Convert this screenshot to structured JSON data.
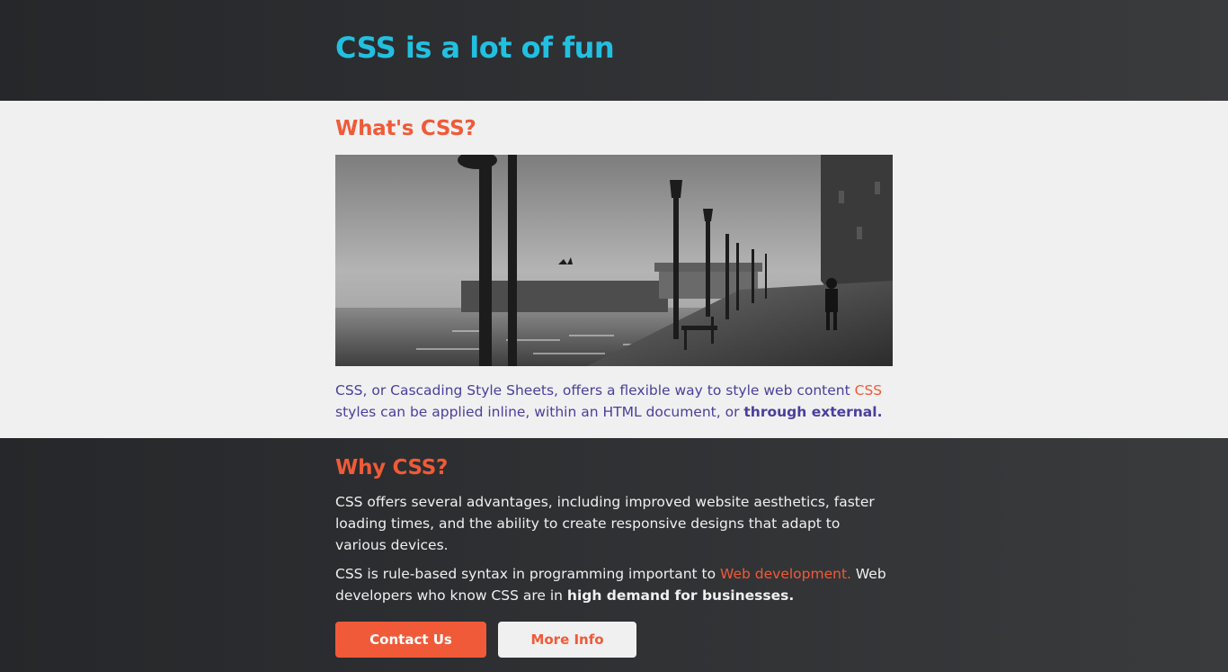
{
  "header": {
    "title": "CSS is a lot of fun"
  },
  "whats_css": {
    "heading": "What's CSS?",
    "paragraph_start": "CSS, or Cascading Style Sheets, offers a flexible way to style web content ",
    "paragraph_accent": "CSS",
    "paragraph_middle": " styles can be applied inline, within an HTML document, or ",
    "paragraph_bold": "through external."
  },
  "why_css": {
    "heading": "Why CSS?",
    "paragraph1": "CSS offers several advantages, including improved website aesthetics, faster loading times, and the ability to create responsive designs that adapt to various devices.",
    "paragraph2_start": "CSS is rule-based syntax in programming important to ",
    "paragraph2_accent": "Web development.",
    "paragraph2_middle": " Web developers who know CSS are in ",
    "paragraph2_bold": "high demand for businesses.",
    "contact_button": "Contact Us",
    "more_button": "More Info"
  },
  "colors": {
    "title": "#22c0e0",
    "accent": "#f05a38",
    "body_text_light": "#4a3f9c",
    "dark_bg": "#25272a",
    "light_bg": "#f0f0f0"
  }
}
